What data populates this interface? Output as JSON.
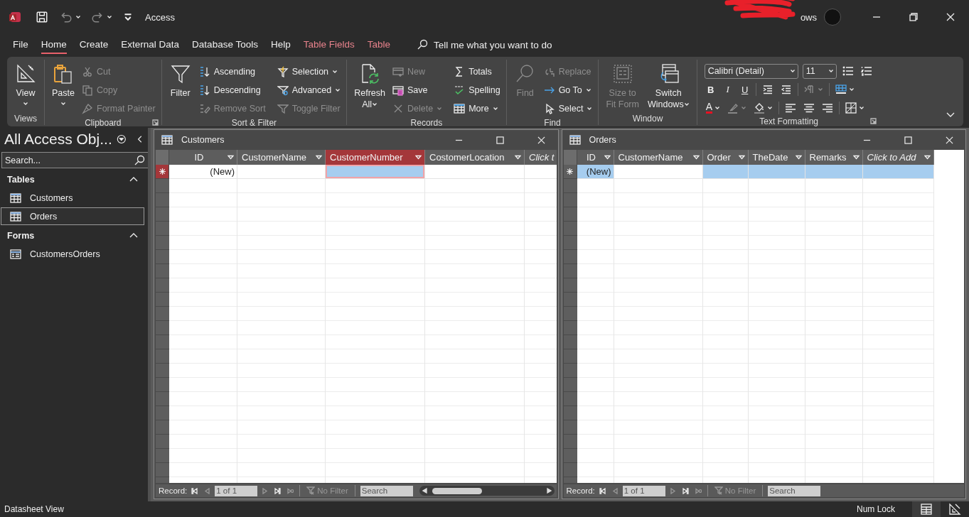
{
  "title_bar": {
    "title": "Access",
    "account_name": "ows"
  },
  "menu_tabs": [
    {
      "label": "File",
      "selected": false,
      "kind": "main"
    },
    {
      "label": "Home",
      "selected": true,
      "kind": "main"
    },
    {
      "label": "Create",
      "selected": false,
      "kind": "main"
    },
    {
      "label": "External Data",
      "selected": false,
      "kind": "main"
    },
    {
      "label": "Database Tools",
      "selected": false,
      "kind": "main"
    },
    {
      "label": "Help",
      "selected": false,
      "kind": "main"
    },
    {
      "label": "Table Fields",
      "selected": false,
      "kind": "contextual"
    },
    {
      "label": "Table",
      "selected": false,
      "kind": "contextual"
    }
  ],
  "tell_me": {
    "placeholder": "Tell me what you want to do"
  },
  "ribbon": {
    "groups": [
      {
        "label": "Views",
        "items": [
          {
            "kind": "large",
            "lines": [
              "View"
            ],
            "dropdown": true,
            "disabled": false
          }
        ]
      },
      {
        "label": "Clipboard",
        "launcher": true,
        "items": [
          {
            "kind": "large",
            "lines": [
              "Paste"
            ],
            "dropdown": true,
            "disabled": false
          },
          {
            "kind": "small",
            "label": "Cut",
            "dropdown": false,
            "disabled": true
          },
          {
            "kind": "small",
            "label": "Copy",
            "dropdown": false,
            "disabled": true
          },
          {
            "kind": "small",
            "label": "Format Painter",
            "dropdown": false,
            "disabled": true
          }
        ]
      },
      {
        "label": "Sort & Filter",
        "items": [
          {
            "kind": "large",
            "lines": [
              "Filter"
            ],
            "dropdown": false,
            "disabled": false
          },
          {
            "kind": "small",
            "label": "Ascending",
            "dropdown": false,
            "disabled": false
          },
          {
            "kind": "small",
            "label": "Descending",
            "dropdown": false,
            "disabled": false
          },
          {
            "kind": "small",
            "label": "Remove Sort",
            "dropdown": false,
            "disabled": true
          },
          {
            "kind": "small",
            "label": "Selection",
            "dropdown": true,
            "disabled": false
          },
          {
            "kind": "small",
            "label": "Advanced",
            "dropdown": true,
            "disabled": false
          },
          {
            "kind": "small",
            "label": "Toggle Filter",
            "dropdown": false,
            "disabled": true
          }
        ]
      },
      {
        "label": "Records",
        "items": [
          {
            "kind": "large",
            "lines": [
              "Refresh",
              "All"
            ],
            "dropdown": true,
            "disabled": false
          },
          {
            "kind": "small",
            "label": "New",
            "dropdown": false,
            "disabled": true
          },
          {
            "kind": "small",
            "label": "Save",
            "dropdown": false,
            "disabled": false
          },
          {
            "kind": "small",
            "label": "Delete",
            "dropdown": true,
            "disabled": true
          },
          {
            "kind": "small",
            "label": "Totals",
            "dropdown": false,
            "disabled": false
          },
          {
            "kind": "small",
            "label": "Spelling",
            "dropdown": false,
            "disabled": false
          },
          {
            "kind": "small",
            "label": "More",
            "dropdown": true,
            "disabled": false
          }
        ]
      },
      {
        "label": "Find",
        "items": [
          {
            "kind": "large",
            "lines": [
              "Find"
            ],
            "dropdown": false,
            "disabled": true
          },
          {
            "kind": "small",
            "label": "Replace",
            "dropdown": false,
            "disabled": true
          },
          {
            "kind": "small",
            "label": "Go To",
            "dropdown": true,
            "disabled": false
          },
          {
            "kind": "small",
            "label": "Select",
            "dropdown": true,
            "disabled": false
          }
        ]
      },
      {
        "label": "Window",
        "items": [
          {
            "kind": "large",
            "lines": [
              "Size to",
              "Fit Form"
            ],
            "dropdown": false,
            "disabled": true
          },
          {
            "kind": "large",
            "lines": [
              "Switch",
              "Windows"
            ],
            "dropdown": true,
            "disabled": false
          }
        ]
      }
    ]
  },
  "text_formatting": {
    "label": "Text Formatting",
    "launcher": true,
    "font": "Calibri (Detail)",
    "size": "11",
    "bold": "B",
    "italic": "I",
    "underline": "U",
    "font_color": "A"
  },
  "navigation_pane": {
    "title": "All Access Obj...",
    "search": {
      "placeholder": "Search..."
    },
    "sections": [
      {
        "label": "Tables",
        "kind": "table",
        "expanded": true,
        "items": [
          {
            "label": "Customers",
            "selected": false
          },
          {
            "label": "Orders",
            "selected": true
          }
        ]
      },
      {
        "label": "Forms",
        "kind": "form",
        "expanded": true,
        "items": [
          {
            "label": "CustomersOrders",
            "selected": false
          }
        ]
      }
    ]
  },
  "windows": [
    {
      "title": "Customers",
      "current": true,
      "columns": [
        {
          "label": "ID",
          "kind": "field",
          "selected": false,
          "dropdown": true
        },
        {
          "label": "CustomerName",
          "kind": "field",
          "selected": false,
          "dropdown": true
        },
        {
          "label": "CustomerNumber",
          "kind": "field",
          "selected": true,
          "dropdown": true
        },
        {
          "label": "CostomerLocation",
          "kind": "field",
          "selected": false,
          "dropdown": true
        },
        {
          "label": "Click t",
          "kind": "add",
          "selected": false
        }
      ],
      "new_row": [
        {
          "text": "(New)",
          "highlighted": false,
          "focused": false
        },
        {
          "highlighted": false,
          "focused": false
        },
        {
          "highlighted": true,
          "focused": true
        },
        {
          "highlighted": false,
          "focused": false
        },
        {
          "highlighted": false,
          "focused": false
        }
      ],
      "navigator": {
        "label": "Record:",
        "position": "1 of 1",
        "filter": "No Filter",
        "search_placeholder": "Search",
        "scrollbar": true
      }
    },
    {
      "title": "Orders",
      "current": false,
      "columns": [
        {
          "label": "ID",
          "kind": "field",
          "selected": false,
          "dropdown": true
        },
        {
          "label": "CustomerName",
          "kind": "field",
          "selected": false,
          "dropdown": true
        },
        {
          "label": "Order",
          "kind": "field",
          "selected": false,
          "dropdown": true
        },
        {
          "label": "TheDate",
          "kind": "field",
          "selected": false,
          "dropdown": true
        },
        {
          "label": "Remarks",
          "kind": "field",
          "selected": false,
          "dropdown": true
        },
        {
          "label": "Click to Add",
          "kind": "add",
          "selected": false,
          "dropdown": true
        }
      ],
      "new_row": [
        {
          "text": "(New)",
          "highlighted": true,
          "focused": false
        },
        {
          "highlighted": false,
          "focused": false
        },
        {
          "highlighted": true,
          "focused": false
        },
        {
          "highlighted": true,
          "focused": false
        },
        {
          "highlighted": true,
          "focused": false
        },
        {
          "highlighted": true,
          "focused": false
        }
      ],
      "navigator": {
        "label": "Record:",
        "position": "1 of 1",
        "filter": "No Filter",
        "search_placeholder": "Search"
      }
    }
  ],
  "status_bar": {
    "view_name": "Datasheet View",
    "indicator": "Num Lock",
    "view_buttons": [
      {
        "selected": true
      },
      {
        "selected": false
      }
    ]
  }
}
